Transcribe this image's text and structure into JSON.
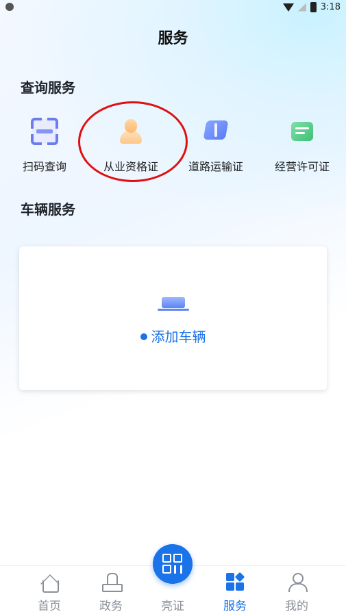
{
  "status": {
    "time": "3:18"
  },
  "header": {
    "title": "服务"
  },
  "query_section": {
    "title": "查询服务",
    "items": [
      {
        "label": "扫码查询",
        "icon": "scan-icon"
      },
      {
        "label": "从业资格证",
        "icon": "person-icon"
      },
      {
        "label": "道路运输证",
        "icon": "road-icon"
      },
      {
        "label": "经营许可证",
        "icon": "license-icon"
      }
    ]
  },
  "vehicle_section": {
    "title": "车辆服务",
    "add_label": "添加车辆",
    "icon": "truck-icon"
  },
  "tabbar": {
    "items": [
      {
        "label": "首页",
        "icon": "home-icon"
      },
      {
        "label": "政务",
        "icon": "stamp-icon"
      },
      {
        "label": "亮证",
        "icon": "qr-code-icon"
      },
      {
        "label": "服务",
        "icon": "services-icon",
        "active": true
      },
      {
        "label": "我的",
        "icon": "profile-icon"
      }
    ],
    "active_color": "#1a73e8",
    "inactive_color": "#8a8f99"
  },
  "highlight_color": "#e01010"
}
